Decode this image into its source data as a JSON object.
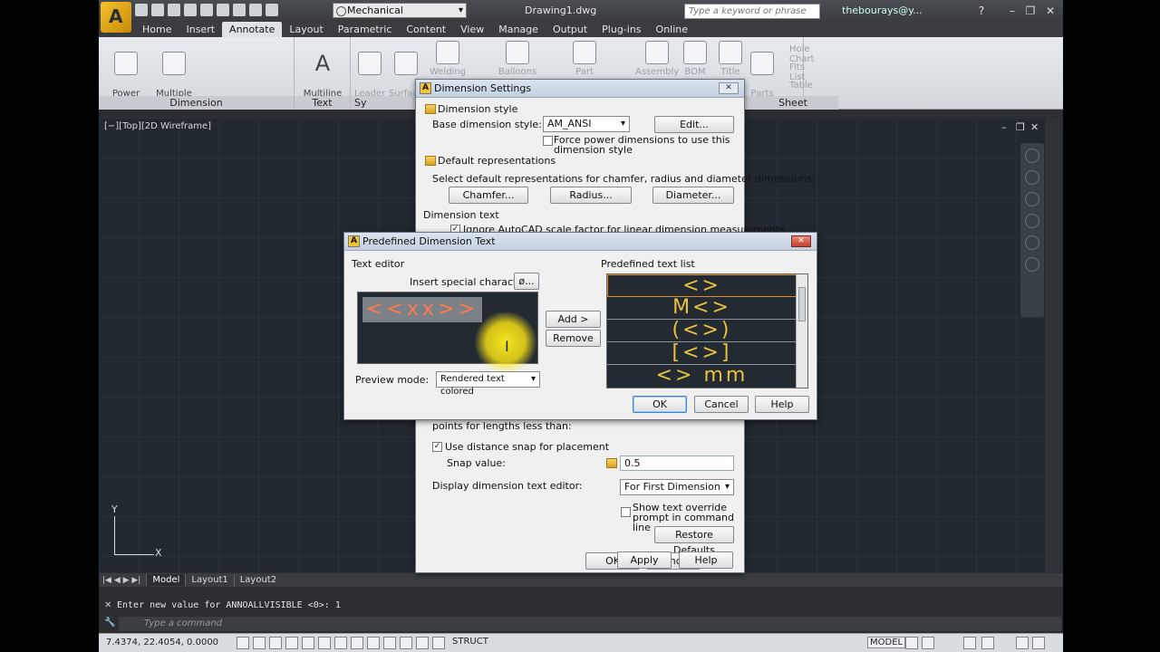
{
  "titlebar": {
    "workspace": "Mechanical",
    "doc_title": "Drawing1.dwg",
    "search_placeholder": "Type a keyword or phrase",
    "user": "thebourays@y..."
  },
  "tabs": [
    "Home",
    "Insert",
    "Annotate",
    "Layout",
    "Parametric",
    "Content",
    "View",
    "Manage",
    "Output",
    "Plug-ins",
    "Online"
  ],
  "ribbon": {
    "power_dimension": "Power\nDimension",
    "multiple_dimension": "Multiple\nDimension",
    "multiline_text": "Multiline\nText",
    "leader_note": "Leader\nNote",
    "surface_texture": "Surface\nTexture",
    "welding": "Welding",
    "balloons": "Balloons",
    "part": "Part",
    "assembly": "Assembly",
    "bom": "BOM",
    "title": "Title",
    "parts_list": "Parts\nList",
    "hole_chart": "Hole Chart",
    "fits_list": "Fits List",
    "table": "Table",
    "panel_dimension": "Dimension",
    "panel_text": "Text",
    "panel_sy": "Sy",
    "panel_sheet": "Sheet"
  },
  "viewport": {
    "label": "[−][Top][2D Wireframe]",
    "ucs_y": "Y",
    "ucs_x": "X"
  },
  "layout_tabs": [
    "Model",
    "Layout1",
    "Layout2"
  ],
  "command": {
    "history": "Enter new value for ANNOALLVISIBLE <0>: 1",
    "placeholder": "Type a command"
  },
  "status": {
    "coords": "7.4374, 22.4054, 0.0000",
    "struct": "STRUCT",
    "model": "MODEL"
  },
  "dim_settings": {
    "title": "Dimension Settings",
    "dimension_style": "Dimension style",
    "base_style_label": "Base dimension style:",
    "base_style_value": "AM_ANSI",
    "edit_button": "Edit...",
    "force_power": "Force power dimensions to use this dimension style",
    "default_repr": "Default representations",
    "default_repr_desc": "Select default representations for chamfer, radius and diameter dimensions:",
    "chamfer_button": "Chamfer...",
    "radius_button": "Radius...",
    "diameter_button": "Diameter...",
    "dimension_text": "Dimension text",
    "ignore_scale": "Ignore AutoCAD scale factor for linear dimension measurements",
    "points_lengths": "points for lengths less than:",
    "use_snap": "Use distance snap for placement",
    "snap_label": "Snap value:",
    "snap_value": "0.5",
    "display_editor_label": "Display dimension text editor:",
    "display_editor_value": "For First Dimension",
    "show_override": "Show text override prompt in command line",
    "restore_defaults": "Restore Defaults",
    "ok": "OK",
    "cancel": "Cancel",
    "apply": "Apply",
    "help": "Help"
  },
  "predefined": {
    "title": "Predefined Dimension Text",
    "text_editor": "Text editor",
    "insert_special": "Insert special characters:",
    "special_button": "ø...",
    "editor_text": "<<xx>>",
    "add_button": "Add >",
    "remove_button": "Remove",
    "preview_label": "Preview mode:",
    "preview_value": "Rendered text colored",
    "list_label": "Predefined text list",
    "list_items": [
      "<>",
      "M<>",
      "(<>)",
      "[<>]",
      "<>  mm"
    ],
    "ok": "OK",
    "cancel": "Cancel",
    "help": "Help"
  }
}
